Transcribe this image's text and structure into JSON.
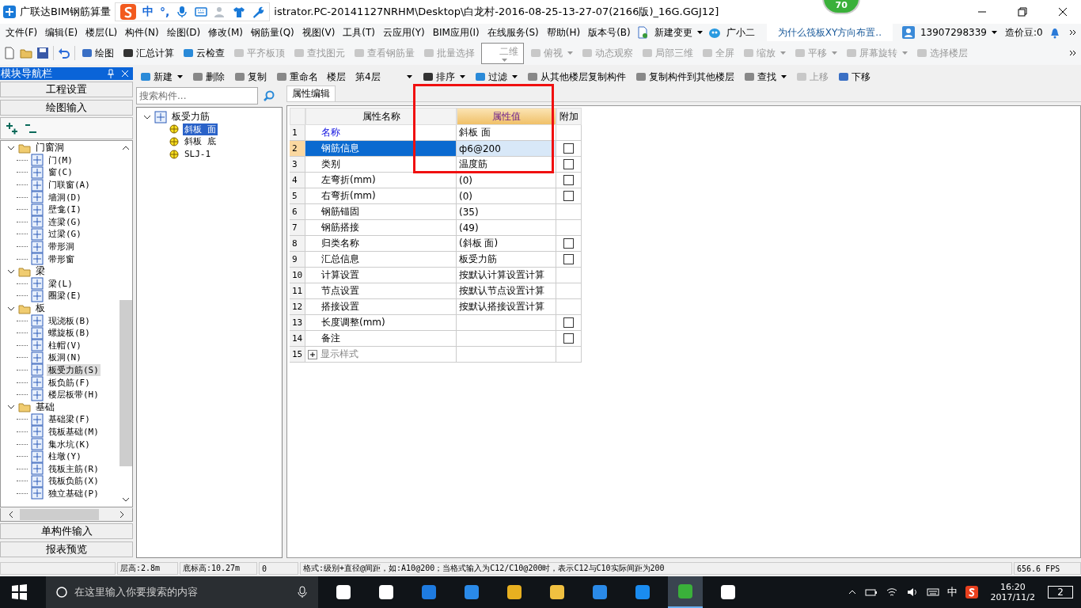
{
  "window": {
    "title_app": "广联达BIM钢筋算量",
    "title_path": "istrator.PC-20141127NRHM\\Desktop\\白龙村-2016-08-25-13-27-07(2166版)_16G.GGJ12]",
    "badge": "70"
  },
  "ime_bar": {
    "items": [
      "中",
      "°,"
    ]
  },
  "menu": [
    "文件(F)",
    "编辑(E)",
    "楼层(L)",
    "构件(N)",
    "绘图(D)",
    "修改(M)",
    "钢筋量(Q)",
    "视图(V)",
    "工具(T)",
    "云应用(Y)",
    "BIM应用(I)",
    "在线服务(S)",
    "帮助(H)",
    "版本号(B)"
  ],
  "menu_extras": {
    "new_change": "新建变更",
    "assistant": "广小二",
    "tip_link": "为什么筏板XY方向布置..",
    "account": "13907298339",
    "beans": "造价豆:0"
  },
  "toolbar_main": [
    {
      "label": "绘图",
      "kind": "button",
      "disabled": false
    },
    {
      "label": "汇总计算",
      "kind": "button",
      "disabled": false
    },
    {
      "label": "云检查",
      "kind": "button",
      "disabled": false
    },
    {
      "label": "平齐板顶",
      "kind": "button",
      "disabled": true
    },
    {
      "label": "查找图元",
      "kind": "button",
      "disabled": true
    },
    {
      "label": "查看钢筋量",
      "kind": "button",
      "disabled": true
    },
    {
      "label": "批量选择",
      "kind": "button",
      "disabled": true
    },
    {
      "label": "二维",
      "kind": "combo",
      "disabled": true
    },
    {
      "label": "俯视",
      "kind": "menu",
      "disabled": true
    },
    {
      "label": "动态观察",
      "kind": "button",
      "disabled": true
    },
    {
      "label": "局部三维",
      "kind": "button",
      "disabled": true
    },
    {
      "label": "全屏",
      "kind": "button",
      "disabled": true
    },
    {
      "label": "缩放",
      "kind": "menu",
      "disabled": true
    },
    {
      "label": "平移",
      "kind": "menu",
      "disabled": true
    },
    {
      "label": "屏幕旋转",
      "kind": "menu",
      "disabled": true
    },
    {
      "label": "选择楼层",
      "kind": "button",
      "disabled": true
    }
  ],
  "toolbar_component": [
    {
      "label": "新建",
      "kind": "menu",
      "disabled": false
    },
    {
      "label": "删除",
      "kind": "button",
      "disabled": false
    },
    {
      "label": "复制",
      "kind": "button",
      "disabled": false
    },
    {
      "label": "重命名",
      "kind": "button",
      "disabled": false
    },
    {
      "label": "楼层",
      "kind": "label"
    },
    {
      "label": "第4层",
      "kind": "combo",
      "disabled": false
    },
    {
      "label": "排序",
      "kind": "menu",
      "disabled": false
    },
    {
      "label": "过滤",
      "kind": "menu",
      "disabled": false
    },
    {
      "label": "从其他楼层复制构件",
      "kind": "button",
      "disabled": false
    },
    {
      "label": "复制构件到其他楼层",
      "kind": "button",
      "disabled": false
    },
    {
      "label": "查找",
      "kind": "menu",
      "disabled": false
    },
    {
      "label": "上移",
      "kind": "button",
      "disabled": true
    },
    {
      "label": "下移",
      "kind": "button",
      "disabled": false
    }
  ],
  "nav": {
    "title": "模块导航栏",
    "top_buttons": [
      "工程设置",
      "绘图输入"
    ],
    "tree": [
      {
        "label": "门窗洞",
        "expanded": true,
        "children": [
          {
            "label": "门(M)",
            "selected": false
          },
          {
            "label": "窗(C)",
            "selected": false
          },
          {
            "label": "门联窗(A)",
            "selected": false
          },
          {
            "label": "墙洞(D)",
            "selected": false
          },
          {
            "label": "壁龛(I)",
            "selected": false
          },
          {
            "label": "连梁(G)",
            "selected": false
          },
          {
            "label": "过梁(G)",
            "selected": false
          },
          {
            "label": "带形洞",
            "selected": false
          },
          {
            "label": "带形窗",
            "selected": false
          }
        ]
      },
      {
        "label": "梁",
        "expanded": true,
        "children": [
          {
            "label": "梁(L)",
            "selected": false
          },
          {
            "label": "圈梁(E)",
            "selected": false
          }
        ]
      },
      {
        "label": "板",
        "expanded": true,
        "children": [
          {
            "label": "现浇板(B)",
            "selected": false
          },
          {
            "label": "螺旋板(B)",
            "selected": false
          },
          {
            "label": "柱帽(V)",
            "selected": false
          },
          {
            "label": "板洞(N)",
            "selected": false
          },
          {
            "label": "板受力筋(S)",
            "selected": true
          },
          {
            "label": "板负筋(F)",
            "selected": false
          },
          {
            "label": "楼层板带(H)",
            "selected": false
          }
        ]
      },
      {
        "label": "基础",
        "expanded": true,
        "children": [
          {
            "label": "基础梁(F)",
            "selected": false
          },
          {
            "label": "筏板基础(M)",
            "selected": false
          },
          {
            "label": "集水坑(K)",
            "selected": false
          },
          {
            "label": "柱墩(Y)",
            "selected": false
          },
          {
            "label": "筏板主筋(R)",
            "selected": false
          },
          {
            "label": "筏板负筋(X)",
            "selected": false
          },
          {
            "label": "独立基础(P)",
            "selected": false
          }
        ]
      }
    ],
    "bottom_buttons": [
      "单构件输入",
      "报表预览"
    ]
  },
  "component_tree": {
    "search_placeholder": "搜索构件...",
    "root": {
      "label": "板受力筋",
      "expanded": true,
      "children": [
        {
          "label": "斜板 面",
          "selected": true
        },
        {
          "label": "斜板 底",
          "selected": false
        },
        {
          "label": "SLJ-1",
          "selected": false
        }
      ]
    }
  },
  "properties": {
    "tab": "属性编辑",
    "columns": [
      "属性名称",
      "属性值",
      "附加"
    ],
    "rows": [
      {
        "index": "1",
        "name": "名称",
        "value": "斜板 面",
        "kind": "key",
        "selected": false
      },
      {
        "index": "2",
        "name": "钢筋信息",
        "value": "ф6@200",
        "kind": "normal",
        "selected": true,
        "checked": false
      },
      {
        "index": "3",
        "name": "类别",
        "value": "温度筋",
        "kind": "normal",
        "selected": false,
        "checked": false
      },
      {
        "index": "4",
        "name": "左弯折(mm)",
        "value": "(0)",
        "kind": "normal",
        "selected": false,
        "checked": false
      },
      {
        "index": "5",
        "name": "右弯折(mm)",
        "value": "(0)",
        "kind": "normal",
        "selected": false,
        "checked": false
      },
      {
        "index": "6",
        "name": "钢筋锚固",
        "value": "(35)",
        "kind": "normal",
        "selected": false
      },
      {
        "index": "7",
        "name": "钢筋搭接",
        "value": "(49)",
        "kind": "normal",
        "selected": false
      },
      {
        "index": "8",
        "name": "归类名称",
        "value": "(斜板 面)",
        "kind": "normal",
        "selected": false,
        "checked": false
      },
      {
        "index": "9",
        "name": "汇总信息",
        "value": "板受力筋",
        "kind": "normal",
        "selected": false,
        "checked": false
      },
      {
        "index": "10",
        "name": "计算设置",
        "value": "按默认计算设置计算",
        "kind": "normal",
        "selected": false
      },
      {
        "index": "11",
        "name": "节点设置",
        "value": "按默认节点设置计算",
        "kind": "normal",
        "selected": false
      },
      {
        "index": "12",
        "name": "搭接设置",
        "value": "按默认搭接设置计算",
        "kind": "normal",
        "selected": false
      },
      {
        "index": "13",
        "name": "长度调整(mm)",
        "kind": "normal",
        "selected": false,
        "checked": false
      },
      {
        "index": "14",
        "name": "备注",
        "kind": "normal",
        "selected": false,
        "checked": false
      },
      {
        "index": "15",
        "name": "显示样式",
        "kind": "group",
        "selected": false,
        "expanded": false
      }
    ]
  },
  "status_bar": [
    "层高:2.8m",
    "底标高:10.27m",
    "0",
    "格式:级别+直径@间距，如:A10@200；当格式输入为C12/C10@200时，表示C12与C10实际间距为200",
    "656.6 FPS"
  ],
  "taskbar": {
    "search_placeholder": "在这里输入你要搜索的内容",
    "apps": [
      {
        "selected": false
      },
      {
        "selected": false
      },
      {
        "selected": false
      },
      {
        "selected": false
      },
      {
        "selected": false
      },
      {
        "selected": false
      },
      {
        "selected": false
      },
      {
        "selected": false
      },
      {
        "selected": true
      },
      {
        "selected": false
      }
    ],
    "ime": "中",
    "time": "16:20",
    "date": "2017/11/2",
    "notifications": "2"
  }
}
